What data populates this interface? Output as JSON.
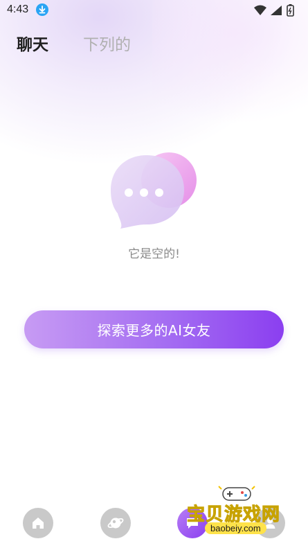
{
  "status_bar": {
    "time": "4:43",
    "icons": [
      "download-icon",
      "wifi-icon",
      "signal-icon",
      "battery-icon"
    ]
  },
  "tabs": [
    {
      "label": "聊天",
      "active": true
    },
    {
      "label": "下列的",
      "active": false
    }
  ],
  "empty_state": {
    "illustration": "chat-bubbles-icon",
    "message": "它是空的!"
  },
  "cta": {
    "label": "探索更多的AI女友"
  },
  "bottom_nav": {
    "items": [
      {
        "icon": "home-icon",
        "active": false
      },
      {
        "icon": "planet-icon",
        "active": false
      },
      {
        "icon": "chat-icon",
        "active": true
      },
      {
        "icon": "profile-icon",
        "active": false
      }
    ]
  },
  "watermark": {
    "text": "宝贝游戏网",
    "url": "baobeiy.com"
  },
  "colors": {
    "accent_start": "#c79bf3",
    "accent_end": "#8b3ff0",
    "inactive_nav": "#c9c9c9",
    "muted_text": "#8a8a8a"
  }
}
